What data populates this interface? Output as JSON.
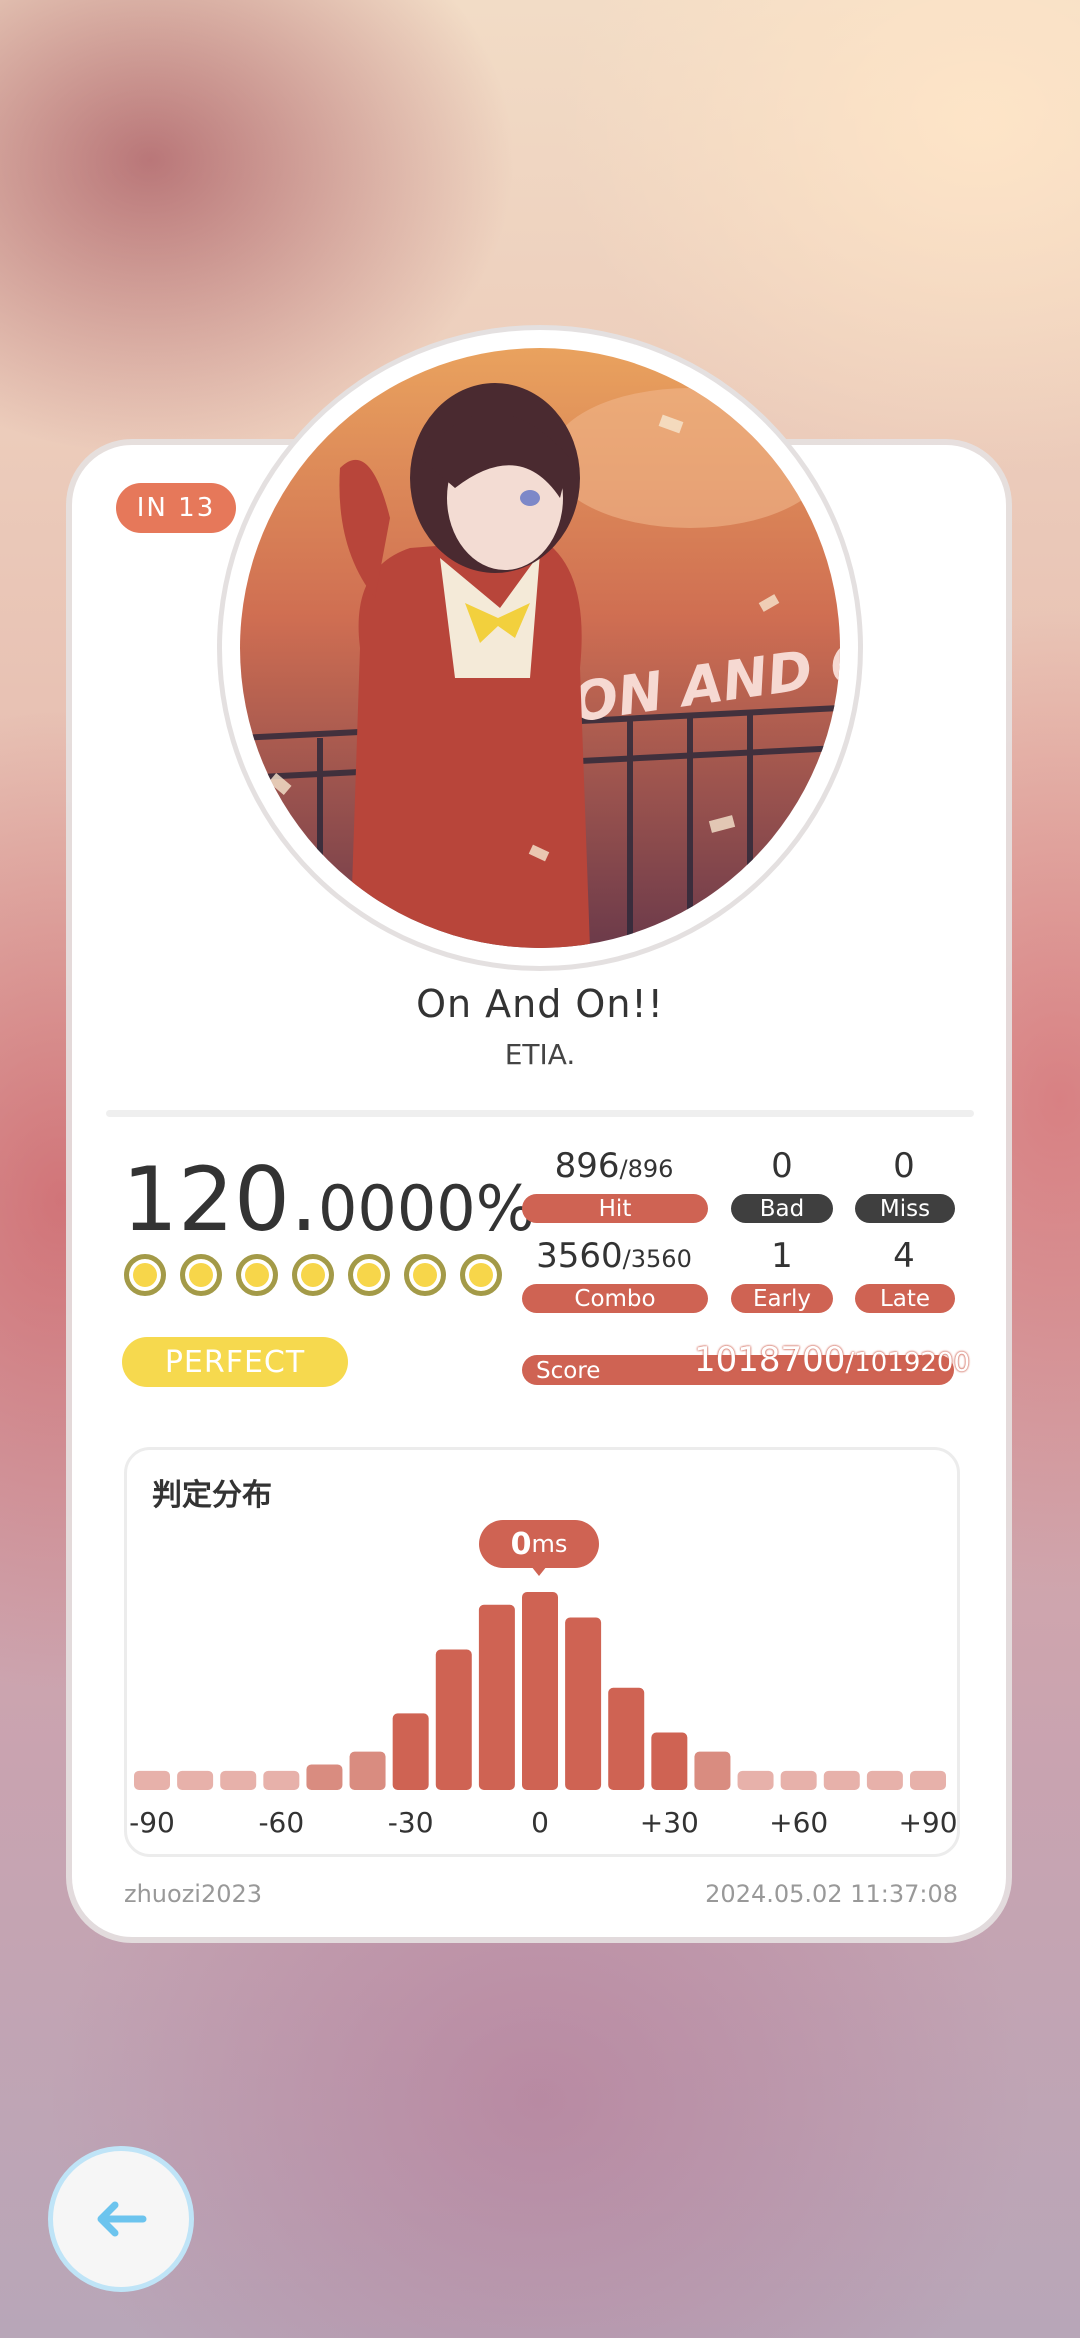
{
  "song": {
    "difficulty_badge": "IN  13",
    "title": "On And On!!",
    "artist": "ETIA.",
    "cover_art_text": "ON AND ON!!"
  },
  "result": {
    "accuracy_main": "120.",
    "accuracy_fraction": "0000%",
    "rank": "PERFECT",
    "stars_count": 7
  },
  "stats": {
    "hit": {
      "value": "896",
      "total": "/896",
      "label": "Hit"
    },
    "bad": {
      "value": "0",
      "label": "Bad"
    },
    "miss": {
      "value": "0",
      "label": "Miss"
    },
    "combo": {
      "value": "3560",
      "total": "/3560",
      "label": "Combo"
    },
    "early": {
      "value": "1",
      "label": "Early"
    },
    "late": {
      "value": "4",
      "label": "Late"
    },
    "score": {
      "label": "Score",
      "value": "1018700",
      "total": "/1019200"
    }
  },
  "histogram": {
    "title": "判定分布",
    "peak_value": "0",
    "peak_unit": "ms",
    "colors": {
      "main": "#cf6353",
      "light": "#e7b1aa",
      "mid": "#d98c80"
    }
  },
  "chart_data": {
    "type": "bar",
    "title": "判定分布",
    "x_tick_labels": [
      "-90",
      "-60",
      "-30",
      "0",
      "+30",
      "+60",
      "+90"
    ],
    "categories": [
      "-90",
      "-80",
      "-70",
      "-60",
      "-50",
      "-40",
      "-30",
      "-20",
      "-10",
      "0",
      "+10",
      "+20",
      "+30",
      "+40",
      "+50",
      "+60",
      "+70",
      "+80",
      "+90"
    ],
    "values": [
      3,
      3,
      3,
      3,
      4,
      6,
      12,
      22,
      29,
      31,
      27,
      16,
      9,
      6,
      3,
      3,
      3,
      3,
      3
    ],
    "highlight_label": "0ms"
  },
  "footer": {
    "username": "zhuozi2023",
    "timestamp": "2024.05.02 11:37:08"
  },
  "nav": {
    "back_icon": "arrow-left-icon"
  }
}
